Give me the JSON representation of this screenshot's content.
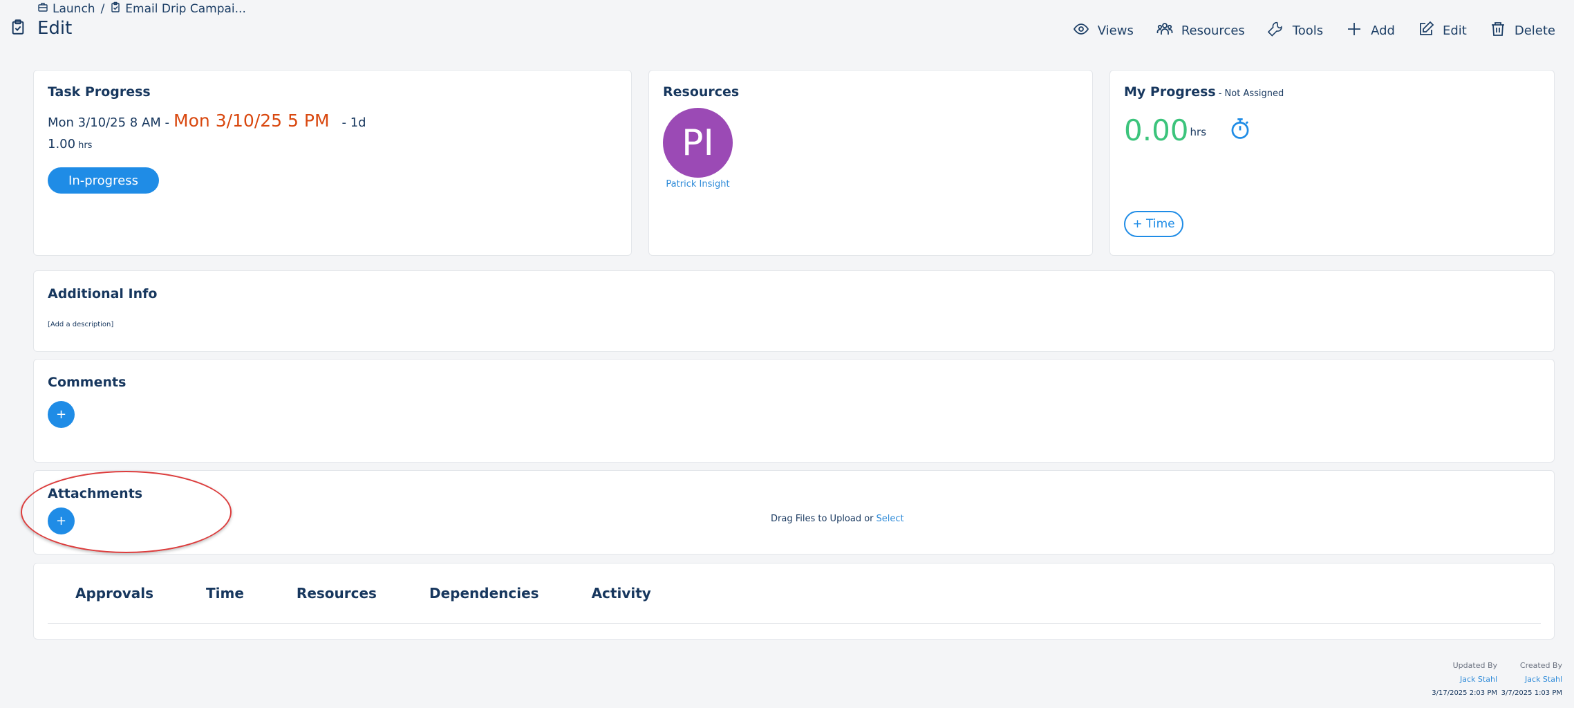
{
  "breadcrumb": {
    "items": [
      {
        "label": "Launch",
        "icon": "briefcase-icon"
      },
      {
        "label": "Email Drip Campai...",
        "icon": "clipboard-check-icon"
      }
    ],
    "separator": "/"
  },
  "page": {
    "title": "Edit",
    "icon": "clipboard-check-icon"
  },
  "toolbar": {
    "views": "Views",
    "resources": "Resources",
    "tools": "Tools",
    "add": "Add",
    "edit": "Edit",
    "delete": "Delete"
  },
  "task_progress": {
    "title": "Task Progress",
    "start": "Mon 3/10/25 8 AM -",
    "end": "Mon 3/10/25 5 PM",
    "duration": "- 1d",
    "hours": "1.00",
    "hours_unit": "hrs",
    "status": "In-progress",
    "end_color": "#d9480f",
    "status_color": "#1f8ce6"
  },
  "resources": {
    "title": "Resources",
    "avatar_initials": "PI",
    "avatar_color": "#9b4ab5",
    "name": "Patrick Insight"
  },
  "my_progress": {
    "title": "My Progress",
    "subtitle": "- Not Assigned",
    "value": "0.00",
    "unit": "hrs",
    "value_color": "#3cc47c",
    "add_time": "+ Time"
  },
  "additional_info": {
    "title": "Additional Info",
    "description_placeholder": "[Add a description]"
  },
  "comments": {
    "title": "Comments",
    "add_label": "+"
  },
  "attachments": {
    "title": "Attachments",
    "add_label": "+",
    "drop_text": "Drag Files to Upload or",
    "select_label": "Select"
  },
  "tabs": [
    "Approvals",
    "Time",
    "Resources",
    "Dependencies",
    "Activity"
  ],
  "footer": {
    "updated_label": "Updated By",
    "updated_user": "Jack Stahl",
    "updated_at": "3/17/2025 2:03 PM",
    "created_label": "Created By",
    "created_user": "Jack Stahl",
    "created_at": "3/7/2025 1:03 PM"
  }
}
